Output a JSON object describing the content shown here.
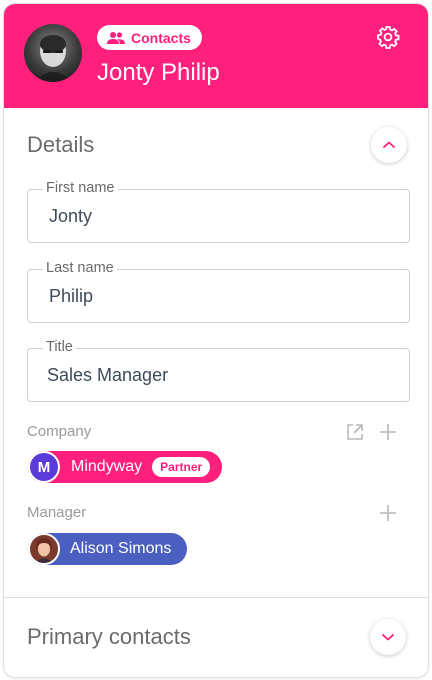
{
  "header": {
    "chip_label": "Contacts",
    "name": "Jonty Philip",
    "accent": "#ff1f7d",
    "icons": [
      "contacts-icon",
      "gear-icon"
    ]
  },
  "details": {
    "title": "Details",
    "expanded": true,
    "fields": [
      {
        "label": "First name",
        "value": "Jonty"
      },
      {
        "label": "Last name",
        "value": "Philip"
      },
      {
        "label": "Title",
        "value": "Sales Manager"
      }
    ],
    "company": {
      "label": "Company",
      "initial": "M",
      "name": "Mindyway",
      "badge": "Partner",
      "color": "#ff1f7d",
      "initial_color": "#5a3ad9"
    },
    "manager": {
      "label": "Manager",
      "name": "Alison Simons",
      "color": "#4a5fbf"
    }
  },
  "primary_contacts": {
    "title": "Primary contacts",
    "expanded": false
  }
}
